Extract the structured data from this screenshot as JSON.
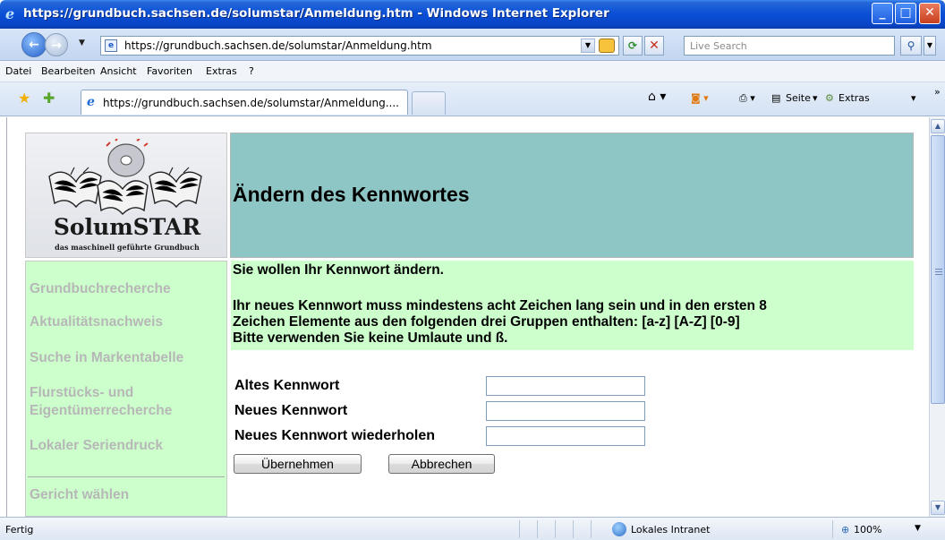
{
  "window": {
    "title": "https://grundbuch.sachsen.de/solumstar/Anmeldung.htm - Windows Internet Explorer"
  },
  "address": {
    "url": "https://grundbuch.sachsen.de/solumstar/Anmeldung.htm",
    "search_placeholder": "Live Search"
  },
  "menu": [
    "Datei",
    "Bearbeiten",
    "Ansicht",
    "Favoriten",
    "Extras",
    "?"
  ],
  "tabs": [
    {
      "label": "https://grundbuch.sachsen.de/solumstar/Anmeldung...."
    }
  ],
  "toolbar": {
    "page_label": "Seite",
    "tools_label": "Extras"
  },
  "logo": {
    "title": "SolumSTAR",
    "subtitle": "das maschinell geführte Grundbuch"
  },
  "page": {
    "heading": "Ändern des Kennwortes",
    "intro": "Sie wollen Ihr Kennwort ändern.",
    "rules_line1": "Ihr neues Kennwort muss mindestens acht Zeichen lang sein und in den ersten 8",
    "rules_line2": "Zeichen Elemente aus den folgenden drei Gruppen enthalten: [a-z] [A-Z] [0-9]",
    "rules_line3": "Bitte verwenden Sie keine Umlaute und ß."
  },
  "sidebar": {
    "items": [
      {
        "label": "Grundbuchrecherche"
      },
      {
        "label": "Aktualitätsnachweis"
      },
      {
        "label": "Suche in Markentabelle"
      },
      {
        "label": "Flurstücks- und"
      },
      {
        "label": "Eigentümerrecherche"
      },
      {
        "label": "Lokaler Seriendruck"
      },
      {
        "label": "Gericht wählen"
      }
    ]
  },
  "form": {
    "old_password_label": "Altes Kennwort",
    "old_password_value": "",
    "new_password_label": "Neues Kennwort",
    "new_password_value": "",
    "repeat_password_label": "Neues Kennwort wiederholen",
    "repeat_password_value": "",
    "submit_label": "Übernehmen",
    "cancel_label": "Abbrechen"
  },
  "status": {
    "text": "Fertig",
    "zone": "Lokales Intranet",
    "zoom": "100%"
  }
}
